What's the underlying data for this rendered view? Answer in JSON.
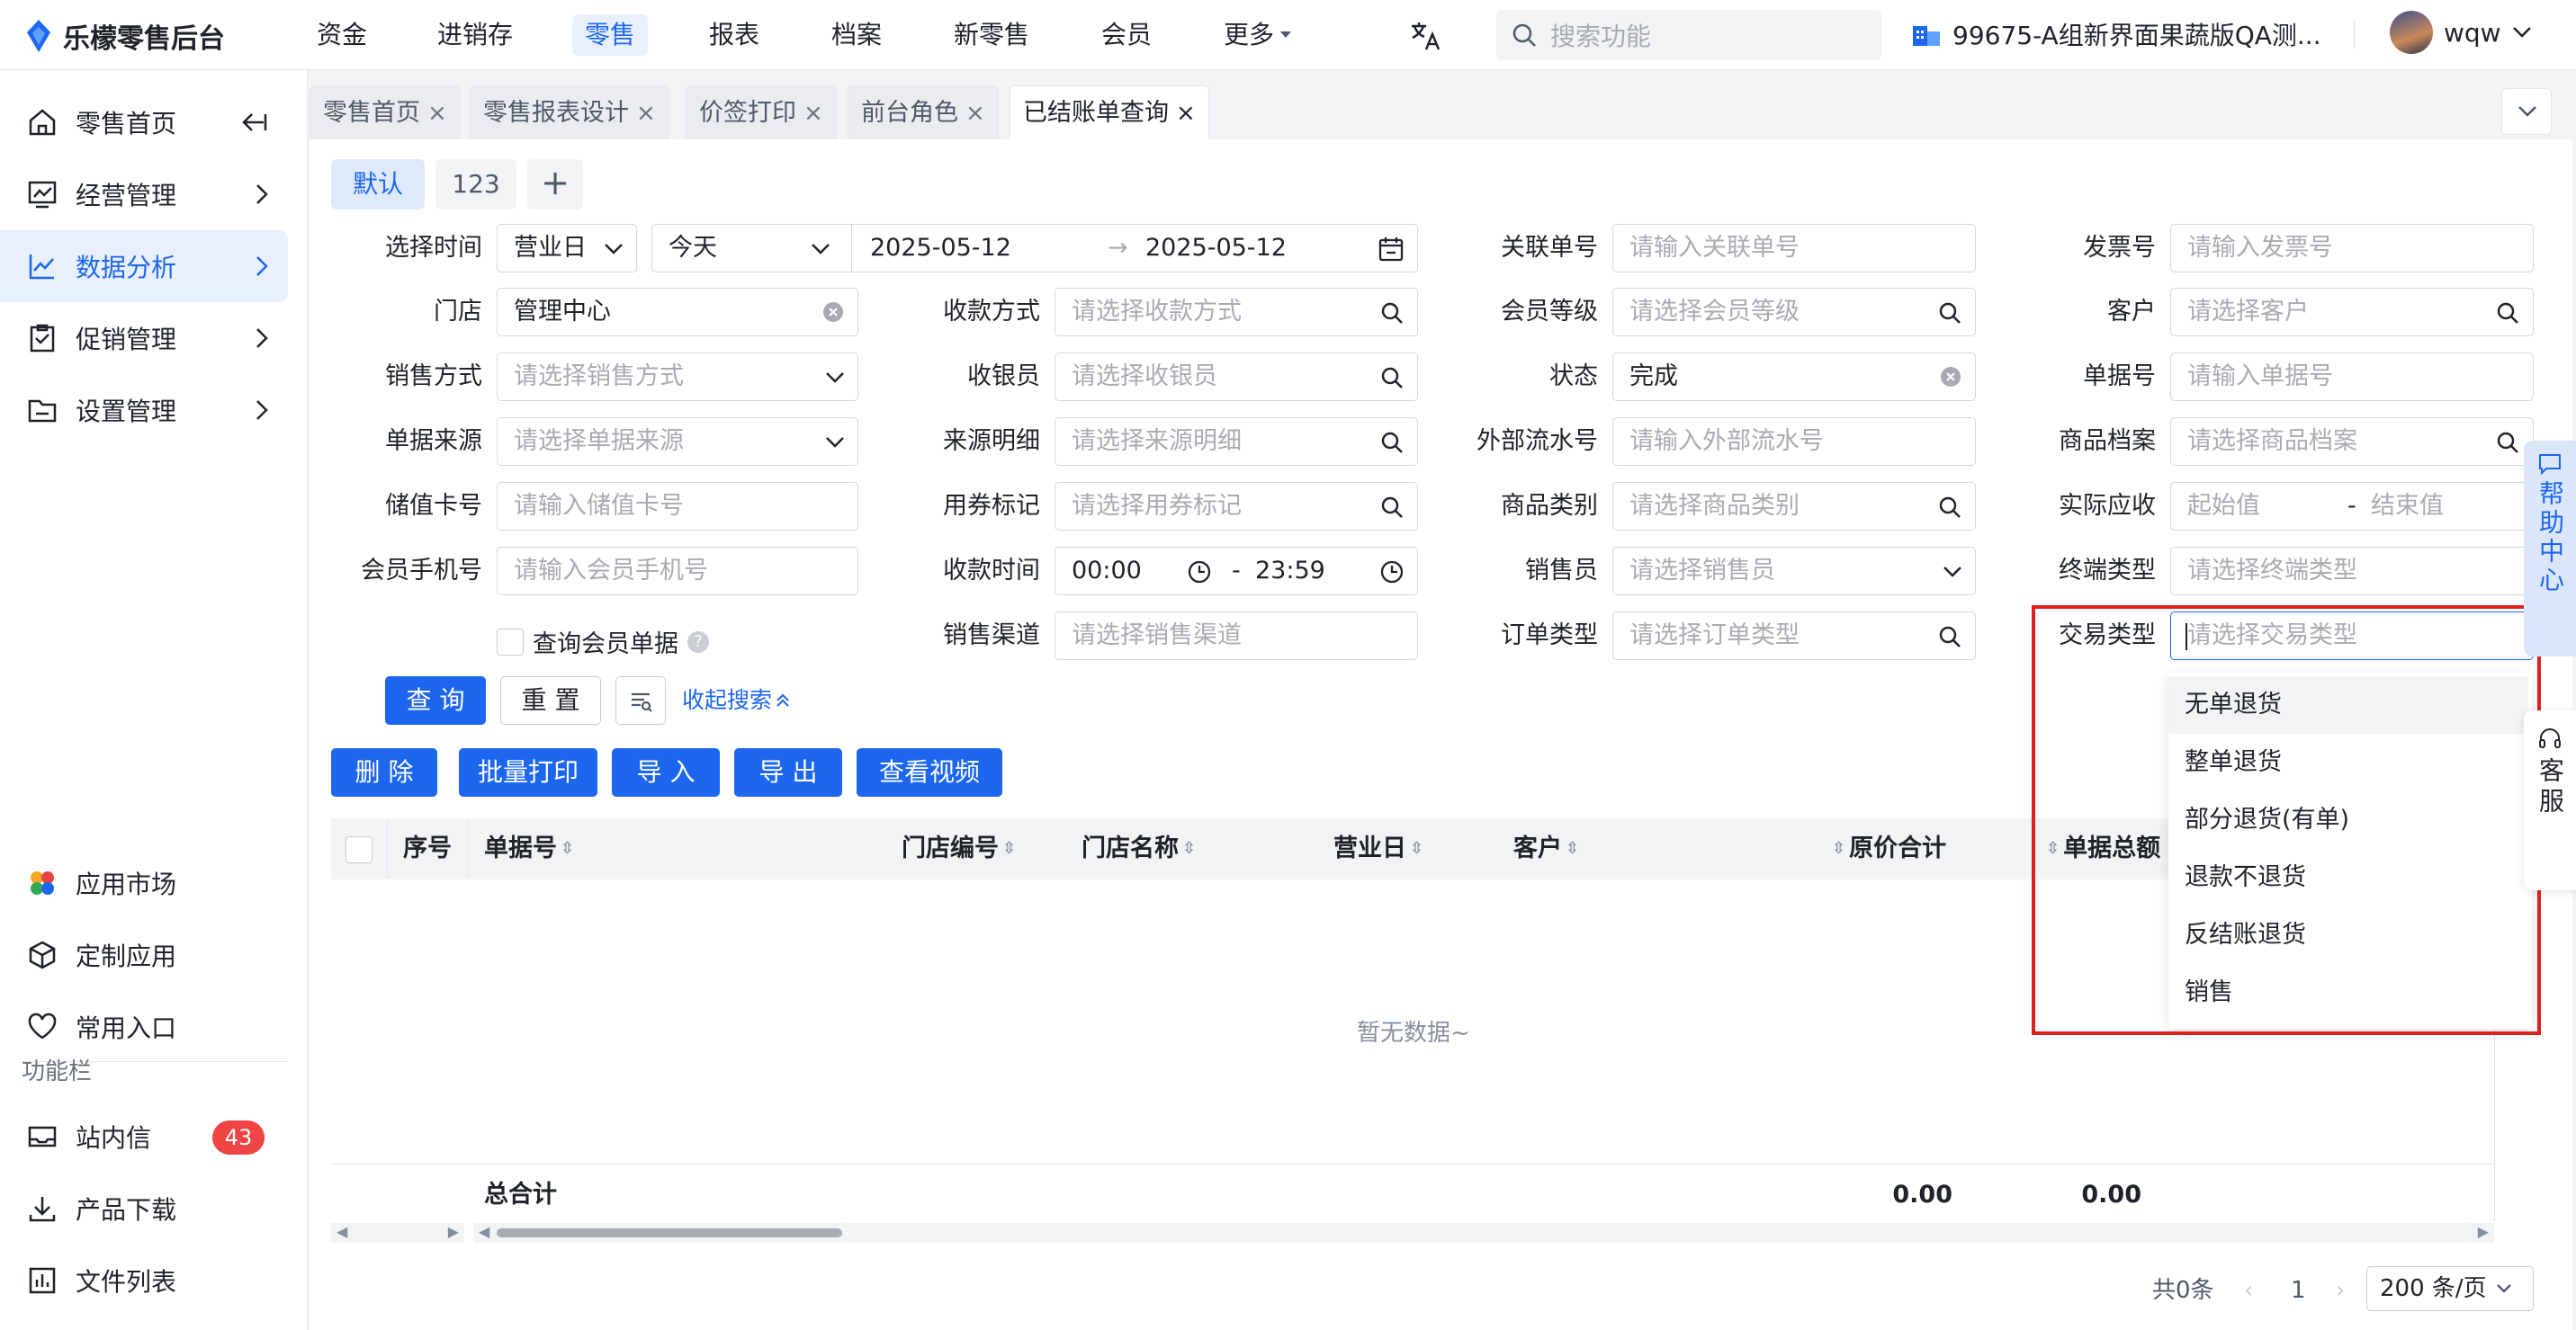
{
  "app": {
    "logo_text": "乐檬零售后台"
  },
  "top_nav": [
    {
      "label": "资金"
    },
    {
      "label": "进销存"
    },
    {
      "label": "零售"
    },
    {
      "label": "报表"
    },
    {
      "label": "档案"
    },
    {
      "label": "新零售"
    },
    {
      "label": "会员"
    },
    {
      "label": "更多"
    }
  ],
  "search": {
    "placeholder": "搜索功能"
  },
  "org": {
    "label": "99675-A组新界面果蔬版QA测..."
  },
  "user": {
    "name": "wqw"
  },
  "sidebar": {
    "items": [
      {
        "label": "零售首页"
      },
      {
        "label": "经营管理"
      },
      {
        "label": "数据分析"
      },
      {
        "label": "促销管理"
      },
      {
        "label": "设置管理"
      }
    ],
    "bottom": [
      {
        "label": "应用市场"
      },
      {
        "label": "定制应用"
      },
      {
        "label": "常用入口"
      }
    ],
    "section_label": "功能栏",
    "utility": [
      {
        "label": "站内信",
        "badge": "43"
      },
      {
        "label": "产品下载"
      },
      {
        "label": "文件列表"
      }
    ]
  },
  "tabs": [
    {
      "label": "零售首页"
    },
    {
      "label": "零售报表设计"
    },
    {
      "label": "价签打印"
    },
    {
      "label": "前台角色"
    },
    {
      "label": "已结账单查询"
    }
  ],
  "scheme_tabs": [
    {
      "label": "默认"
    },
    {
      "label": "123"
    },
    {
      "label": "+"
    }
  ],
  "filters": {
    "time_label": "选择时间",
    "time_type": "营业日",
    "time_range": "今天",
    "date_start": "2025-05-12",
    "date_end": "2025-05-12",
    "store_label": "门店",
    "store_value": "管理中心",
    "sale_mode_label": "销售方式",
    "sale_mode_ph": "请选择销售方式",
    "doc_source_label": "单据来源",
    "doc_source_ph": "请选择单据来源",
    "stored_card_label": "储值卡号",
    "stored_card_ph": "请输入储值卡号",
    "member_phone_label": "会员手机号",
    "member_phone_ph": "请输入会员手机号",
    "member_doc_label": "查询会员单据",
    "pay_method_label": "收款方式",
    "pay_method_ph": "请选择收款方式",
    "cashier_label": "收银员",
    "cashier_ph": "请选择收银员",
    "source_detail_label": "来源明细",
    "source_detail_ph": "请选择来源明细",
    "coupon_label": "用券标记",
    "coupon_ph": "请选择用券标记",
    "pay_time_label": "收款时间",
    "pay_time_start": "00:00",
    "pay_time_end": "23:59",
    "channel_label": "销售渠道",
    "channel_ph": "请选择销售渠道",
    "related_no_label": "关联单号",
    "related_no_ph": "请输入关联单号",
    "member_level_label": "会员等级",
    "member_level_ph": "请选择会员等级",
    "status_label": "状态",
    "status_value": "完成",
    "ext_flow_label": "外部流水号",
    "ext_flow_ph": "请输入外部流水号",
    "category_label": "商品类别",
    "category_ph": "请选择商品类别",
    "salesman_label": "销售员",
    "salesman_ph": "请选择销售员",
    "order_type_label": "订单类型",
    "order_type_ph": "请选择订单类型",
    "invoice_label": "发票号",
    "invoice_ph": "请输入发票号",
    "customer_label": "客户",
    "customer_ph": "请选择客户",
    "doc_no_label": "单据号",
    "doc_no_ph": "请输入单据号",
    "product_label": "商品档案",
    "product_ph": "请选择商品档案",
    "receivable_label": "实际应收",
    "receivable_start_ph": "起始值",
    "receivable_end_ph": "结束值",
    "terminal_label": "终端类型",
    "terminal_ph": "请选择终端类型",
    "trade_type_label": "交易类型",
    "trade_type_ph": "请选择交易类型",
    "dash": "-"
  },
  "actions": {
    "query": "查 询",
    "reset": "重 置",
    "collapse": "收起搜索"
  },
  "toolbar": {
    "delete": "删 除",
    "batch_print": "批量打印",
    "import": "导 入",
    "export": "导 出",
    "video": "查看视频"
  },
  "table": {
    "columns": [
      "序号",
      "单据号",
      "门店编号",
      "门店名称",
      "营业日",
      "客户",
      "原价合计",
      "单据总额"
    ],
    "empty": "暂无数据~",
    "total_label": "总合计",
    "total_original": "0.00",
    "total_amount": "0.00"
  },
  "dropdown": {
    "options": [
      "无单退货",
      "整单退货",
      "部分退货(有单)",
      "退款不退货",
      "反结账退货",
      "销售"
    ]
  },
  "float": {
    "help": "帮助中心",
    "service": "客服"
  },
  "pagination": {
    "total": "共0条",
    "page": "1",
    "size": "200 条/页"
  },
  "colors": {
    "primary": "#1d67f0",
    "highlight": "#e02020",
    "badge": "#f04444"
  }
}
